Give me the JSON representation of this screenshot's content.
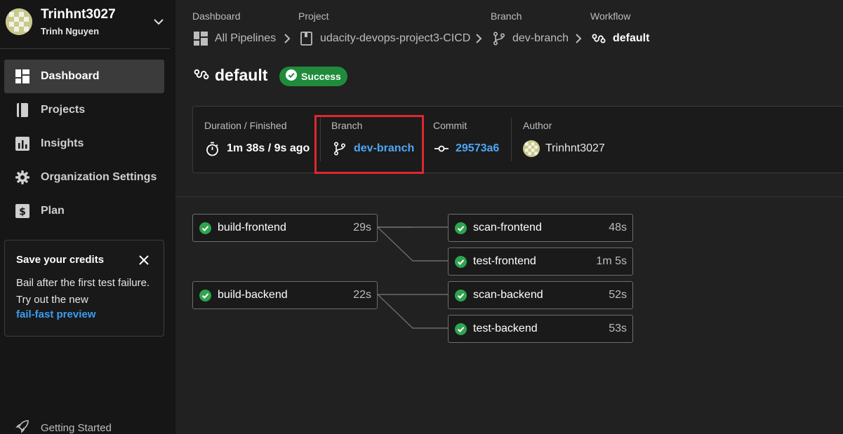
{
  "sidebar": {
    "user": {
      "username": "Trinhnt3027",
      "full_name": "Trinh Nguyen"
    },
    "nav": [
      {
        "label": "Dashboard",
        "icon": "dashboard-icon",
        "active": true
      },
      {
        "label": "Projects",
        "icon": "book-icon",
        "active": false
      },
      {
        "label": "Insights",
        "icon": "bar-chart-icon",
        "active": false
      },
      {
        "label": "Organization Settings",
        "icon": "gear-icon",
        "active": false
      },
      {
        "label": "Plan",
        "icon": "dollar-icon",
        "active": false
      }
    ],
    "credits_card": {
      "title": "Save your credits",
      "body": "Bail after the first test failure. Try out the new",
      "link": "fail-fast preview"
    },
    "getting_started": "Getting Started"
  },
  "breadcrumbs": [
    {
      "label": "Dashboard",
      "value": "All Pipelines",
      "icon": "dashboard-icon"
    },
    {
      "label": "Project",
      "value": "udacity-devops-project3-CICD",
      "icon": "book-icon"
    },
    {
      "label": "Branch",
      "value": "dev-branch",
      "icon": "branch-icon"
    },
    {
      "label": "Workflow",
      "value": "default",
      "icon": "workflow-icon"
    }
  ],
  "workflow": {
    "name": "default",
    "status": "Success"
  },
  "meta": {
    "duration_label": "Duration / Finished",
    "duration_value": "1m 38s / 9s ago",
    "branch_label": "Branch",
    "branch_value": "dev-branch",
    "commit_label": "Commit",
    "commit_value": "29573a6",
    "author_label": "Author",
    "author_value": "Trinhnt3027"
  },
  "jobs": [
    {
      "name": "build-frontend",
      "duration": "29s",
      "status": "success"
    },
    {
      "name": "scan-frontend",
      "duration": "48s",
      "status": "success"
    },
    {
      "name": "test-frontend",
      "duration": "1m 5s",
      "status": "success"
    },
    {
      "name": "build-backend",
      "duration": "22s",
      "status": "success"
    },
    {
      "name": "scan-backend",
      "duration": "52s",
      "status": "success"
    },
    {
      "name": "test-backend",
      "duration": "53s",
      "status": "success"
    }
  ],
  "colors": {
    "success": "#1f8b3b",
    "link": "#4ea6f5",
    "highlight": "#e0262e"
  }
}
